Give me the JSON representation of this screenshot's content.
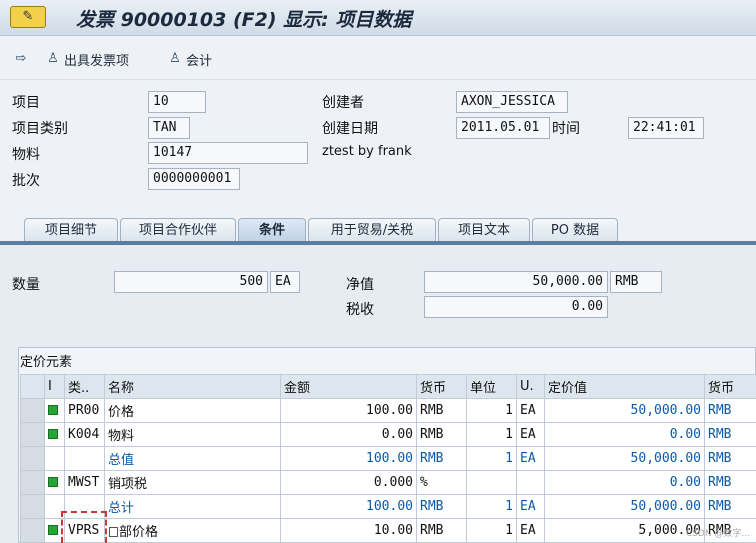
{
  "title": {
    "icon": "invoice-icon",
    "text": "发票 90000103   (F2) 显示: 项目数据"
  },
  "toolbar": {
    "items": [
      {
        "icon": "document-nav-icon",
        "label": ""
      },
      {
        "icon": "user-icon",
        "label": "出具发票项"
      },
      {
        "icon": "user-icon",
        "label": "会计"
      }
    ]
  },
  "header": {
    "item_label": "项目",
    "item_value": "10",
    "item_cat_label": "项目类别",
    "item_cat_value": "TAN",
    "material_label": "物料",
    "material_value": "10147",
    "material_desc": "ztest by frank",
    "batch_label": "批次",
    "batch_value": "0000000001",
    "creator_label": "创建者",
    "creator_value": "AXON_JESSICA",
    "created_label": "创建日期",
    "created_value": "2011.05.01",
    "time_label": "时间",
    "time_value": "22:41:01"
  },
  "tabs": [
    "项目细节",
    "项目合作伙伴",
    "条件",
    "用于贸易/关税",
    "项目文本",
    "PO 数据"
  ],
  "active_tab": "条件",
  "conditions": {
    "qty_label": "数量",
    "qty_value": "500",
    "qty_unit": "EA",
    "net_label": "净值",
    "net_value": "50,000.00",
    "net_curr": "RMB",
    "tax_label": "税收",
    "tax_value": "0.00",
    "group_title": "定价元素",
    "columns": [
      "I",
      "类..",
      "名称",
      "金额",
      "货币",
      "单位",
      "U.",
      "定价值",
      "货币"
    ],
    "rows": [
      {
        "status": "green",
        "type": "PR00",
        "name": "价格",
        "amount": "100.00",
        "curr": "RMB",
        "per": "1",
        "uom": "EA",
        "value": "50,000.00",
        "vcurr": "RMB",
        "subtotal": false
      },
      {
        "status": "green",
        "type": "K004",
        "name": "物料",
        "amount": "0.00",
        "curr": "RMB",
        "per": "1",
        "uom": "EA",
        "value": "0.00",
        "vcurr": "RMB",
        "subtotal": false
      },
      {
        "status": "",
        "type": "",
        "name": "总值",
        "amount": "100.00",
        "curr": "RMB",
        "per": "1",
        "uom": "EA",
        "value": "50,000.00",
        "vcurr": "RMB",
        "subtotal": true
      },
      {
        "status": "green",
        "type": "MWST",
        "name": "销项税",
        "amount": "0.000",
        "curr": "%",
        "per": "",
        "uom": "",
        "value": "0.00",
        "vcurr": "RMB",
        "subtotal": false
      },
      {
        "status": "",
        "type": "",
        "name": "总计",
        "amount": "100.00",
        "curr": "RMB",
        "per": "1",
        "uom": "EA",
        "value": "50,000.00",
        "vcurr": "RMB",
        "subtotal": true
      },
      {
        "status": "green",
        "type": "VPRS",
        "name": "部价格",
        "amount": "10.00",
        "curr": "RMB",
        "per": "1",
        "uom": "EA",
        "value": "5,000.00",
        "vcurr": "RMB",
        "subtotal": false,
        "checkbox": true
      }
    ]
  },
  "watermark": "CSDN @数字..."
}
